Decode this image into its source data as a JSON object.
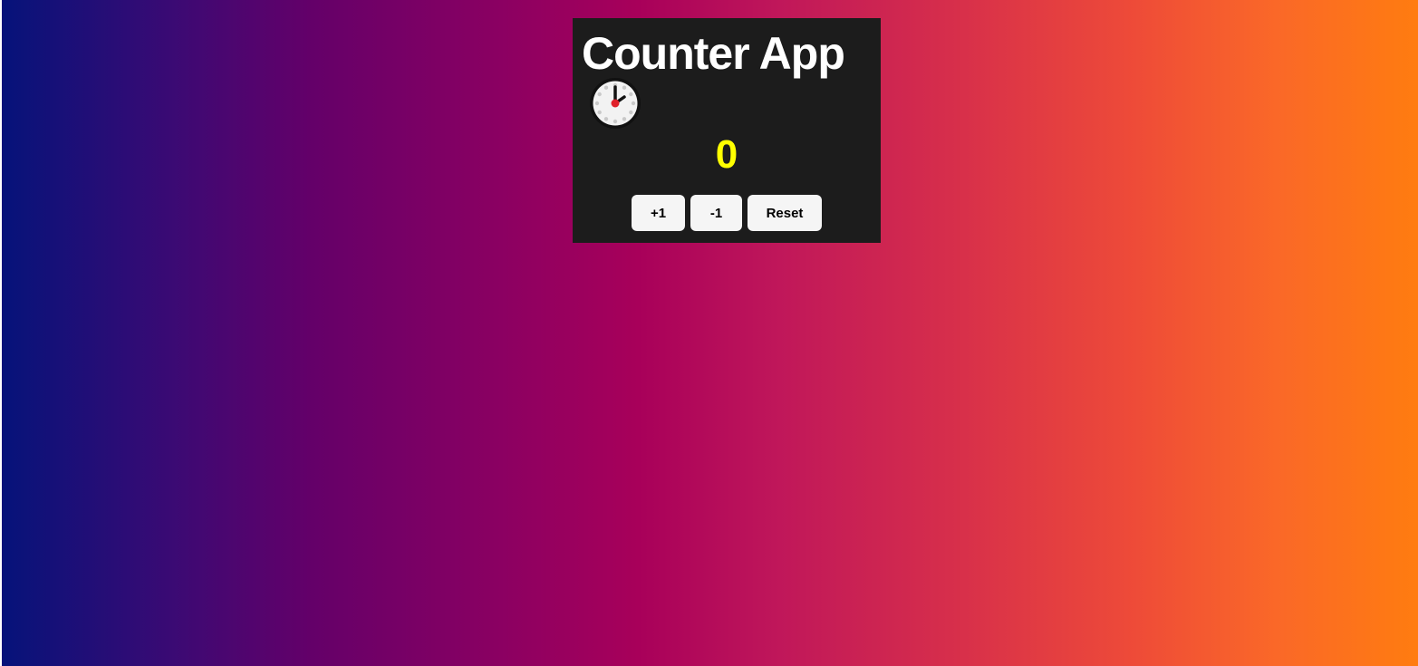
{
  "app": {
    "title": "Counter App",
    "icon": "clock-icon",
    "count": "0"
  },
  "buttons": {
    "increment_label": "+1",
    "decrement_label": "-1",
    "reset_label": "Reset"
  },
  "colors": {
    "card_background": "#1c1c1c",
    "title_color": "#ffffff",
    "count_color": "#ffff00",
    "button_background": "#f5f5f5",
    "gradient_start": "#05137a",
    "gradient_end": "#ff7c10"
  }
}
